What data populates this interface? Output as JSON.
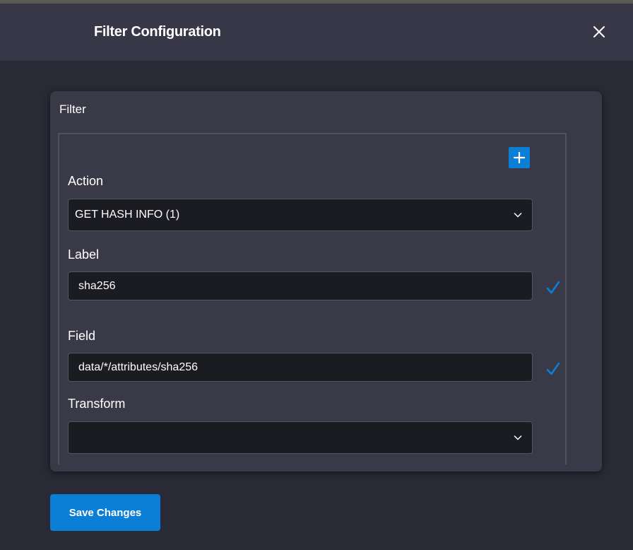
{
  "modal": {
    "title": "Filter Configuration",
    "close_icon": "close-icon"
  },
  "filter": {
    "section_title": "Filter",
    "add_icon": "plus-icon",
    "action": {
      "label": "Action",
      "value": "GET HASH INFO (1)"
    },
    "label_field": {
      "label": "Label",
      "value": "sha256",
      "valid_icon": "checkmark-icon"
    },
    "field": {
      "label": "Field",
      "value": "data/*/attributes/sha256",
      "valid_icon": "checkmark-icon"
    },
    "transform": {
      "label": "Transform",
      "value": ""
    }
  },
  "footer": {
    "save_label": "Save Changes"
  },
  "colors": {
    "accent": "#0b7ed6",
    "background": "#2a2a36",
    "header": "#373747",
    "card": "#393947",
    "input": "#1b1b22"
  }
}
